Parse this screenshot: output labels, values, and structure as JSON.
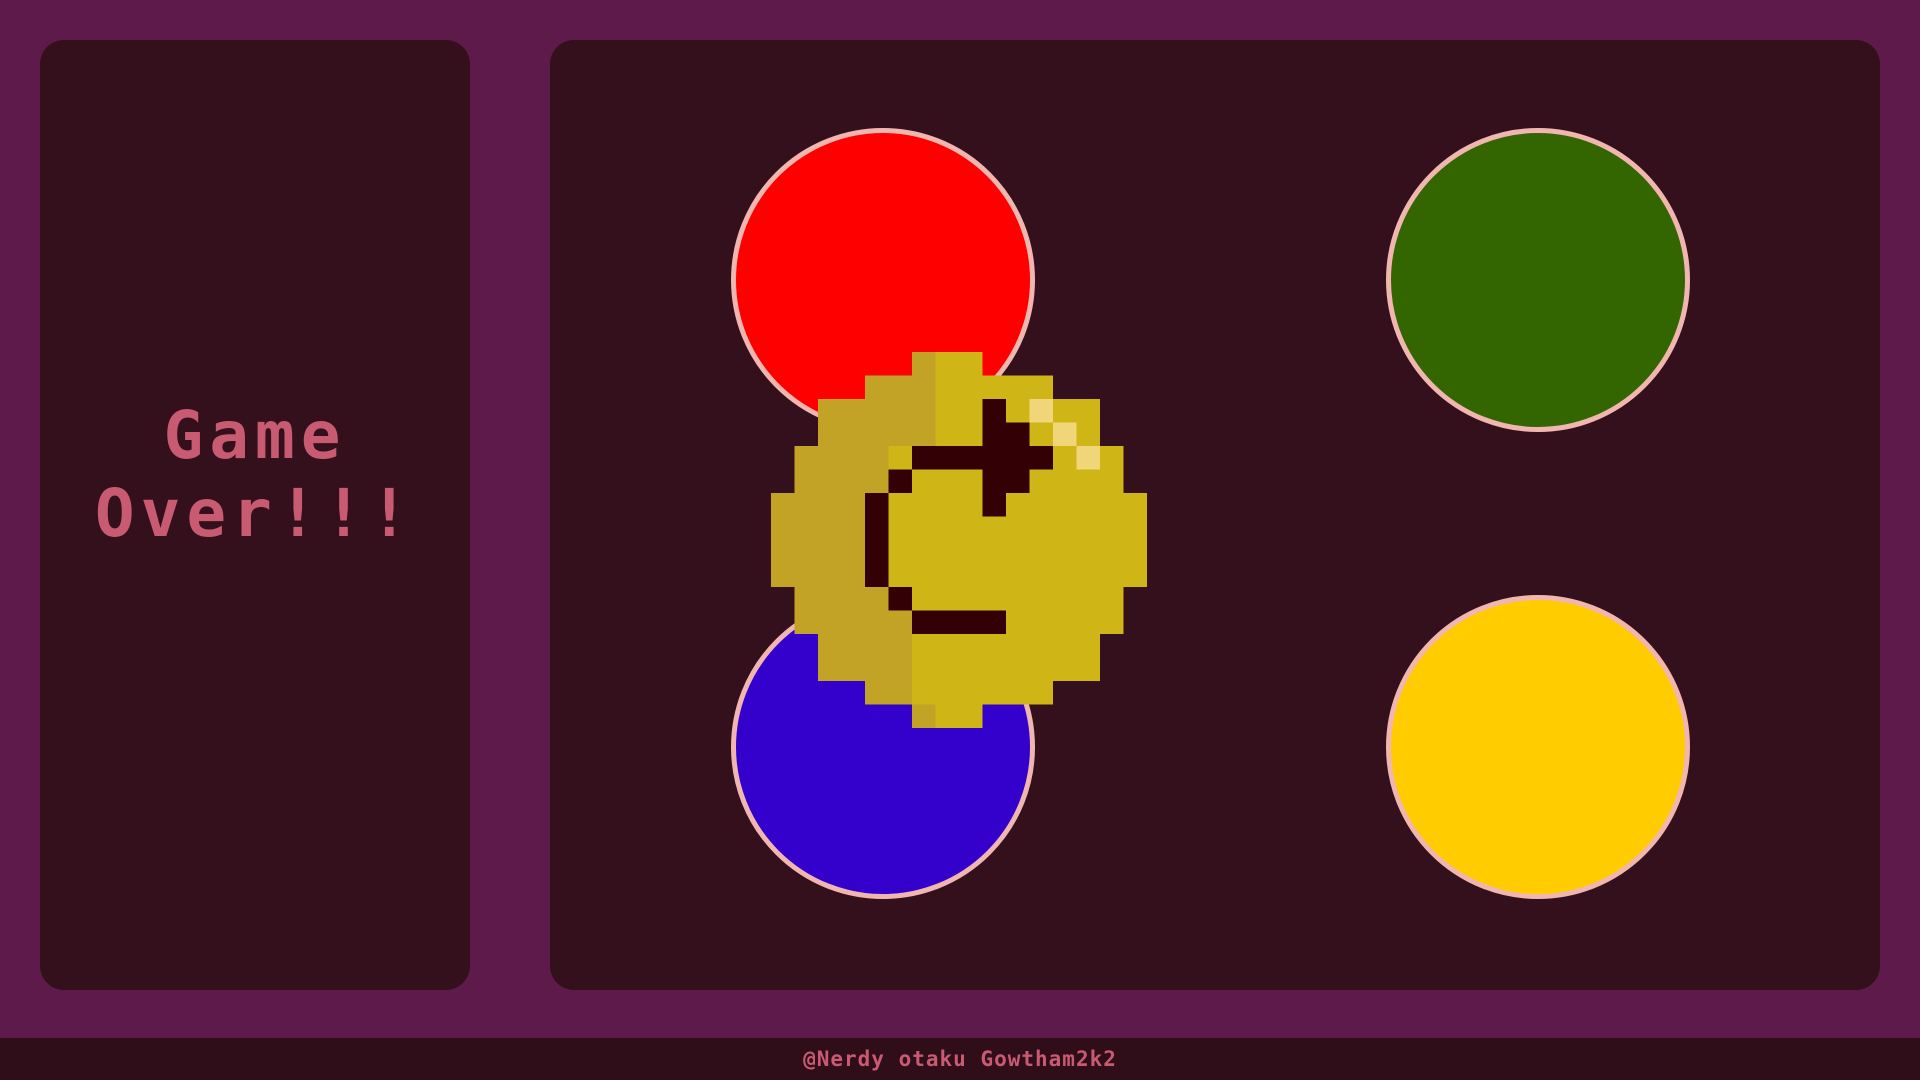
{
  "status": {
    "line1": "Game",
    "line2": "Over!!!"
  },
  "pads": [
    {
      "name": "red-pad",
      "color": "#ff0000"
    },
    {
      "name": "green-pad",
      "color": "#336600"
    },
    {
      "name": "blue-pad",
      "color": "#3300cc"
    },
    {
      "name": "yellow-pad",
      "color": "#ffcc00"
    }
  ],
  "pad_border_color": "#f2b6b0",
  "mascot": {
    "icon": "pixel-smug-face-icon",
    "face_color": "#cfb516",
    "shade_color": "#c2a325",
    "feature_color": "#320005",
    "shine_color": "#f1d679"
  },
  "footer": {
    "credit": "@Nerdy otaku Gowtham2k2"
  },
  "colors": {
    "background": "#5f1a4c",
    "panel": "#34101d",
    "text": "#c85a72"
  }
}
